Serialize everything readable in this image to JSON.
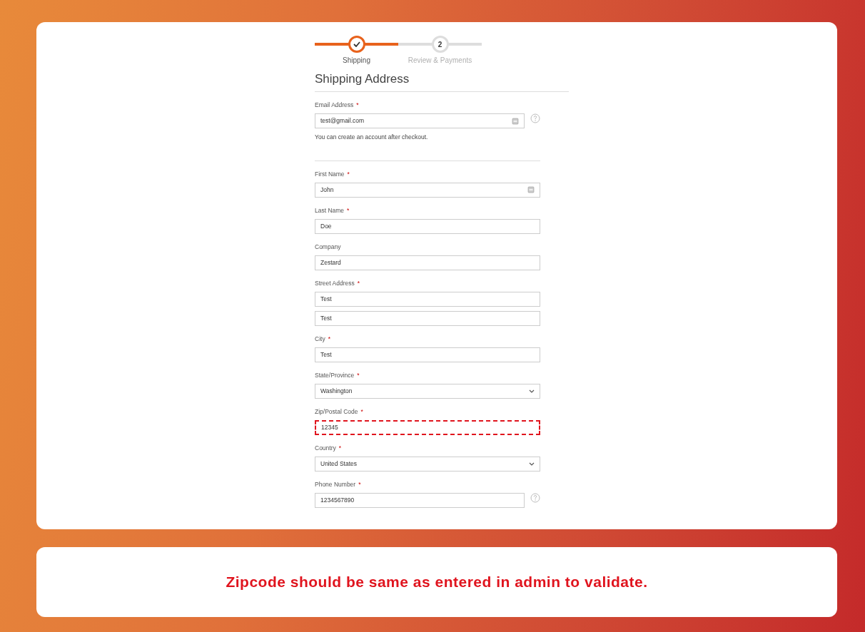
{
  "progress": [
    {
      "label": "Shipping",
      "completed": true
    },
    {
      "label": "Review & Payments",
      "number": "2",
      "completed": false
    }
  ],
  "heading": "Shipping Address",
  "fields": [
    {
      "kind": "text",
      "label": "Email Address",
      "required_mark": "*",
      "values": [
        "test@gmail.com"
      ],
      "autofill_icon": true,
      "help": true,
      "note": "You can create an account after checkout.",
      "divider_after": true
    },
    {
      "kind": "text",
      "label": "First Name",
      "required_mark": "*",
      "values": [
        "John"
      ],
      "autofill_icon": true
    },
    {
      "kind": "text",
      "label": "Last Name",
      "required_mark": "*",
      "values": [
        "Doe"
      ]
    },
    {
      "kind": "text",
      "label": "Company",
      "values": [
        "Zestard"
      ]
    },
    {
      "kind": "text",
      "label": "Street Address",
      "required_mark": "*",
      "values": [
        "Test",
        "Test"
      ]
    },
    {
      "kind": "text",
      "label": "City",
      "required_mark": "*",
      "values": [
        "Test"
      ]
    },
    {
      "kind": "select",
      "label": "State/Province",
      "required_mark": "*",
      "values": [
        "Washington"
      ]
    },
    {
      "kind": "text",
      "label": "Zip/Postal Code",
      "required_mark": "*",
      "values": [
        "12345"
      ],
      "highlighted": true
    },
    {
      "kind": "select",
      "label": "Country",
      "required_mark": "*",
      "values": [
        "United States"
      ]
    },
    {
      "kind": "text",
      "label": "Phone Number",
      "required_mark": "*",
      "values": [
        "1234567890"
      ],
      "help": true
    }
  ],
  "caption": "Zipcode should be same as entered in admin to validate."
}
